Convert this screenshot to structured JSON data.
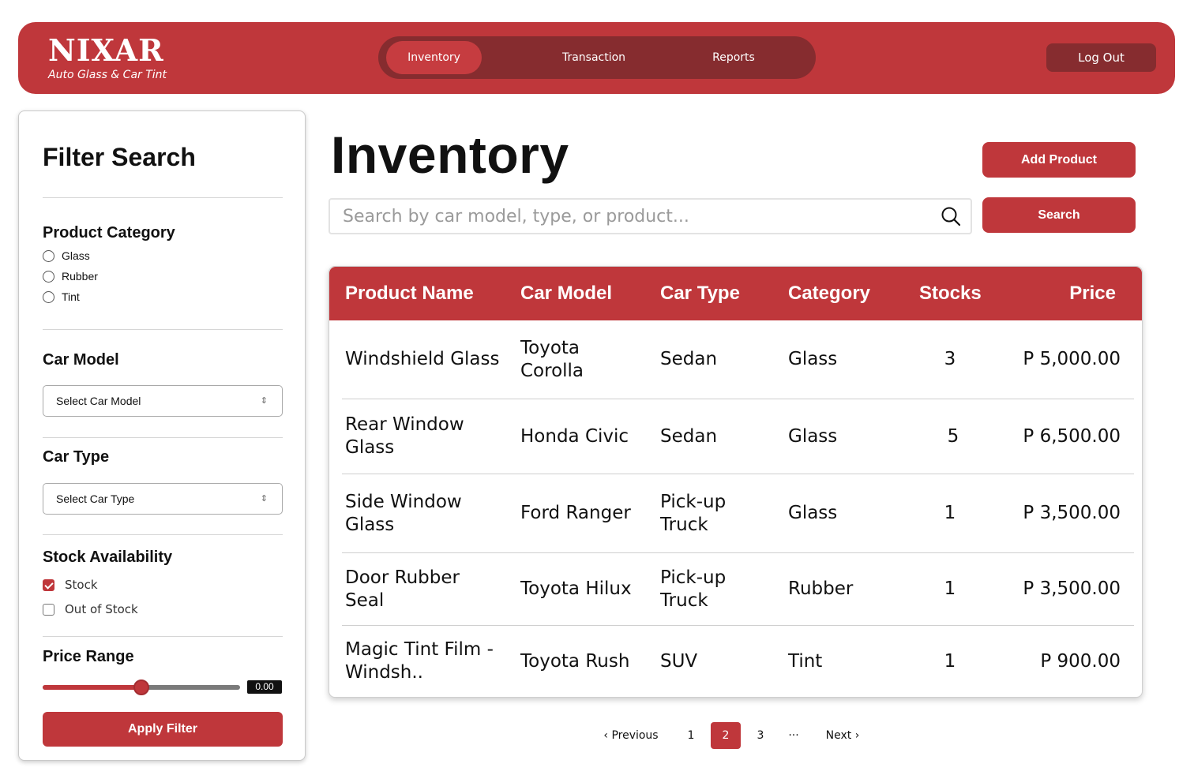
{
  "brand": {
    "name": "NIXAR",
    "subtitle": "Auto Glass & Car Tint"
  },
  "nav": {
    "items": [
      "Inventory",
      "Transaction",
      "Reports"
    ],
    "active": "Inventory"
  },
  "header": {
    "logout_label": "Log Out"
  },
  "sidebar": {
    "title": "Filter Search",
    "product_category": {
      "heading": "Product Category",
      "options": [
        "Glass",
        "Rubber",
        "Tint"
      ]
    },
    "car_model": {
      "heading": "Car Model",
      "select_value": "Select Car Model"
    },
    "car_type": {
      "heading": "Car Type",
      "select_value": "Select Car Type"
    },
    "stock": {
      "heading": "Stock Availability",
      "options": [
        {
          "label": "Stock",
          "checked": true
        },
        {
          "label": "Out of Stock",
          "checked": false
        }
      ]
    },
    "price": {
      "heading": "Price Range",
      "value": "0.00",
      "slider_fraction": 0.5
    },
    "apply_label": "Apply Filter"
  },
  "main": {
    "title": "Inventory",
    "add_label": "Add Product",
    "search_label": "Search",
    "search_placeholder": "Search by car model, type, or product..."
  },
  "table": {
    "headers": [
      "Product Name",
      "Car Model",
      "Car Type",
      "Category",
      "Stocks",
      "Price"
    ],
    "rows": [
      [
        "Windshield Glass",
        "Toyota Corolla",
        "Sedan",
        "Glass",
        "3",
        "P 5,000.00"
      ],
      [
        "Rear Window Glass",
        "Honda Civic",
        "Sedan",
        "Glass",
        "5",
        "P 6,500.00"
      ],
      [
        "Side Window Glass",
        "Ford Ranger",
        "Pick-up Truck",
        "Glass",
        "1",
        "P 3,500.00"
      ],
      [
        "Door Rubber Seal",
        "Toyota Hilux",
        "Pick-up Truck",
        "Rubber",
        "1",
        "P 3,500.00"
      ],
      [
        "Magic Tint Film - Windsh..",
        "Toyota Rush",
        "SUV",
        "Tint",
        "1",
        "P 900.00"
      ]
    ]
  },
  "pagination": {
    "previous": "Previous",
    "pages": [
      "1",
      "2",
      "3"
    ],
    "active": "2",
    "ellipsis": "···",
    "next": "Next"
  },
  "colors": {
    "accent": "#bf373b",
    "accent_dark": "#862c2f"
  }
}
